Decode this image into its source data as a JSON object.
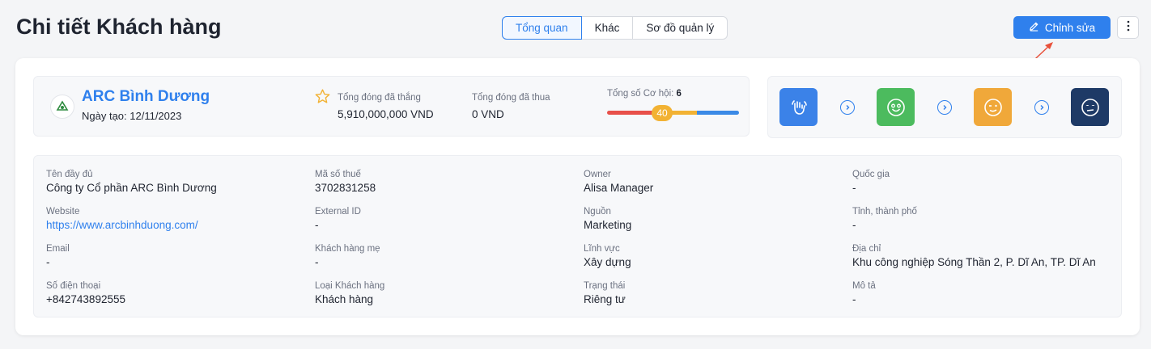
{
  "page": {
    "title": "Chi tiết Khách hàng"
  },
  "tabs": [
    {
      "label": "Tổng quan",
      "active": true
    },
    {
      "label": "Khác",
      "active": false
    },
    {
      "label": "Sơ đồ quản lý",
      "active": false
    }
  ],
  "actions": {
    "edit_label": "Chỉnh sửa",
    "edit_icon": "pencil-icon",
    "more_icon": "kebab-menu-icon"
  },
  "summary": {
    "company_name": "ARC Bình Dương",
    "created_label": "Ngày tạo: 12/11/2023",
    "won_label": "Tổng đóng đã thắng",
    "won_value": "5,910,000,000 VND",
    "lost_label": "Tổng đóng đã thua",
    "lost_value": "0 VND",
    "opportunities_label": "Tổng số Cơ hội:",
    "opportunities_count": "6",
    "score": "40",
    "score_colors": [
      "#e8504a",
      "#f2b233",
      "#3b8ae6"
    ]
  },
  "stages": [
    {
      "icon": "wave-hand-icon",
      "color": "#3b82e8"
    },
    {
      "icon": "happy-face-icon",
      "color": "#4cbb5e"
    },
    {
      "icon": "wink-face-icon",
      "color": "#f0a83a"
    },
    {
      "icon": "neutral-face-icon",
      "color": "#1e3a66"
    }
  ],
  "details": {
    "col1": [
      {
        "label": "Tên đầy đủ",
        "value": "Công ty Cổ phần ARC Bình Dương"
      },
      {
        "label": "Website",
        "value": "https://www.arcbinhduong.com/",
        "link": true
      },
      {
        "label": "Email",
        "value": "-"
      },
      {
        "label": "Số điện thoại",
        "value": "+842743892555"
      }
    ],
    "col2": [
      {
        "label": "Mã số thuế",
        "value": "3702831258"
      },
      {
        "label": "External ID",
        "value": "-"
      },
      {
        "label": "Khách hàng mẹ",
        "value": "-"
      },
      {
        "label": "Loại Khách hàng",
        "value": "Khách hàng"
      }
    ],
    "col3": [
      {
        "label": "Owner",
        "value": "Alisa Manager"
      },
      {
        "label": "Nguồn",
        "value": "Marketing"
      },
      {
        "label": "Lĩnh vực",
        "value": "Xây dựng"
      },
      {
        "label": "Trạng thái",
        "value": "Riêng tư"
      }
    ],
    "col4": [
      {
        "label": "Quốc gia",
        "value": "-"
      },
      {
        "label": "Tỉnh, thành phố",
        "value": "-"
      },
      {
        "label": "Địa chỉ",
        "value": "Khu công nghiệp Sóng Thần 2, P. Dĩ An, TP. Dĩ An"
      },
      {
        "label": "Mô tả",
        "value": "-"
      }
    ]
  }
}
